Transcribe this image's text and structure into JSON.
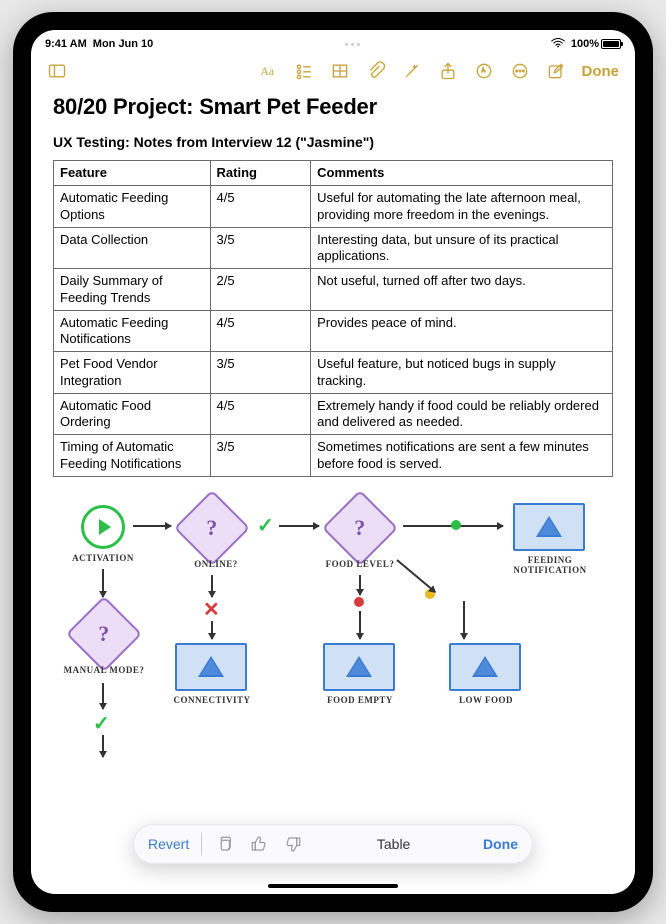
{
  "status": {
    "time": "9:41 AM",
    "date": "Mon Jun 10",
    "battery_pct": "100%"
  },
  "toolbar": {
    "done_label": "Done"
  },
  "note": {
    "title": "80/20 Project: Smart Pet Feeder",
    "subtitle": "UX Testing: Notes from Interview 12 (\"Jasmine\")"
  },
  "table": {
    "headers": [
      "Feature",
      "Rating",
      "Comments"
    ],
    "rows": [
      {
        "feature": "Automatic Feeding Options",
        "rating": "4/5",
        "comments": "Useful for automating the late afternoon meal, providing more freedom in the evenings."
      },
      {
        "feature": "Data Collection",
        "rating": "3/5",
        "comments": "Interesting data, but unsure of its practical applications."
      },
      {
        "feature": "Daily Summary of Feeding Trends",
        "rating": "2/5",
        "comments": "Not useful, turned off after two days."
      },
      {
        "feature": "Automatic Feeding Notifications",
        "rating": "4/5",
        "comments": "Provides peace of mind."
      },
      {
        "feature": "Pet Food Vendor Integration",
        "rating": "3/5",
        "comments": "Useful feature, but noticed bugs in supply tracking."
      },
      {
        "feature": "Automatic Food Ordering",
        "rating": "4/5",
        "comments": "Extremely handy if food could be reliably ordered and delivered as needed."
      },
      {
        "feature": "Timing of Automatic Feeding Notifications",
        "rating": "3/5",
        "comments": "Sometimes notifications are sent a few minutes before food is served."
      }
    ]
  },
  "flow": {
    "activation": "Activation",
    "manual_mode": "Manual Mode?",
    "online": "Online?",
    "connectivity": "Connectivity",
    "food_level": "Food Level?",
    "food_empty": "Food Empty",
    "low_food": "Low Food",
    "feeding_notification": "Feeding Notification"
  },
  "actionbar": {
    "revert": "Revert",
    "mode": "Table",
    "done": "Done"
  }
}
